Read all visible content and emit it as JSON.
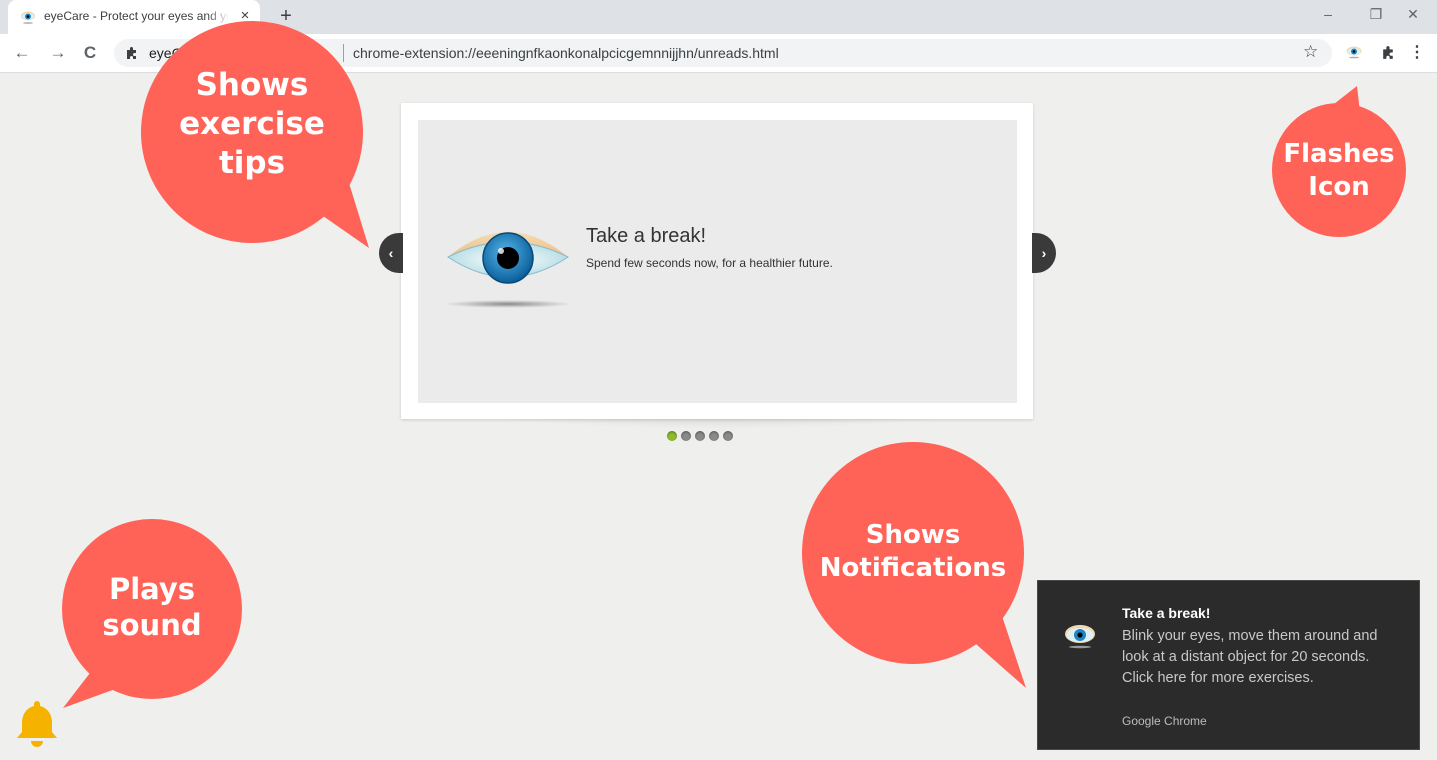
{
  "browser": {
    "tab_title": "eyeCare - Protect your eyes and your vision",
    "tab_close": "×",
    "new_tab": "+",
    "window_controls": {
      "minimize": "–",
      "restore": "❐",
      "close": "✕"
    },
    "nav": {
      "back": "←",
      "forward": "→",
      "reload": "C"
    },
    "omnibox": {
      "extension_name": "eyeCare - Protect your vision",
      "url": "chrome-extension://eeeningnfkaonkonalpcicgemnnijjhn/unreads.html"
    },
    "star": "☆",
    "menu": "⋮"
  },
  "slider": {
    "slide_title": "Take a break!",
    "slide_subtitle": "Spend few seconds now, for a healthier future.",
    "prev": "‹",
    "next": "›",
    "dots_count": 5,
    "active_dot": 0
  },
  "callouts": {
    "exercise_tips": "Shows\nexercise\ntips",
    "flashes_icon": "Flashes\nIcon",
    "plays_sound": "Plays\nsound",
    "shows_notifications": "Shows\nNotifications"
  },
  "notification": {
    "title": "Take a break!",
    "body": "Blink your eyes, move them around and look at a distant object for 20 seconds. Click here for more exercises.",
    "source": "Google Chrome"
  },
  "colors": {
    "callout": "#ff6257",
    "accent_dot": "#8dbb2a",
    "bell": "#f5b300",
    "notification_bg": "#2b2b2b"
  },
  "icons": [
    "eye-icon",
    "puzzle-icon",
    "star-icon",
    "bell-icon",
    "chevron-left-icon",
    "chevron-right-icon"
  ]
}
